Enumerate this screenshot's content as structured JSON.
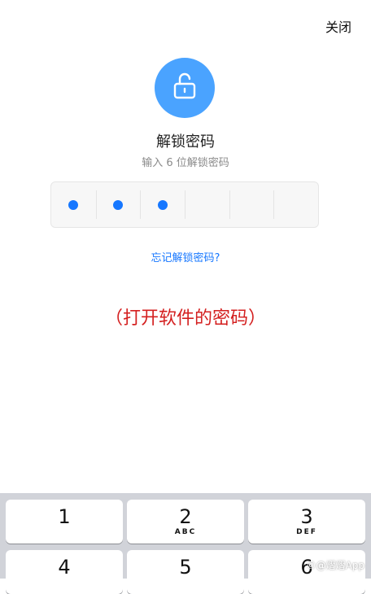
{
  "header": {
    "close_label": "关闭"
  },
  "lock": {
    "icon": "unlock-icon",
    "color": "#4aa3ff"
  },
  "title": "解锁密码",
  "subtitle": "输入 6 位解锁密码",
  "pin": {
    "length": 6,
    "filled": 3,
    "dot_color": "#1677ff"
  },
  "forgot_label": "忘记解锁密码?",
  "caption": "（打开软件的密码）",
  "keypad": {
    "keys": [
      {
        "num": "1",
        "letters": ""
      },
      {
        "num": "2",
        "letters": "ABC"
      },
      {
        "num": "3",
        "letters": "DEF"
      },
      {
        "num": "4",
        "letters": ""
      },
      {
        "num": "5",
        "letters": ""
      },
      {
        "num": "6",
        "letters": ""
      }
    ]
  },
  "watermark": "©@熠熠App"
}
